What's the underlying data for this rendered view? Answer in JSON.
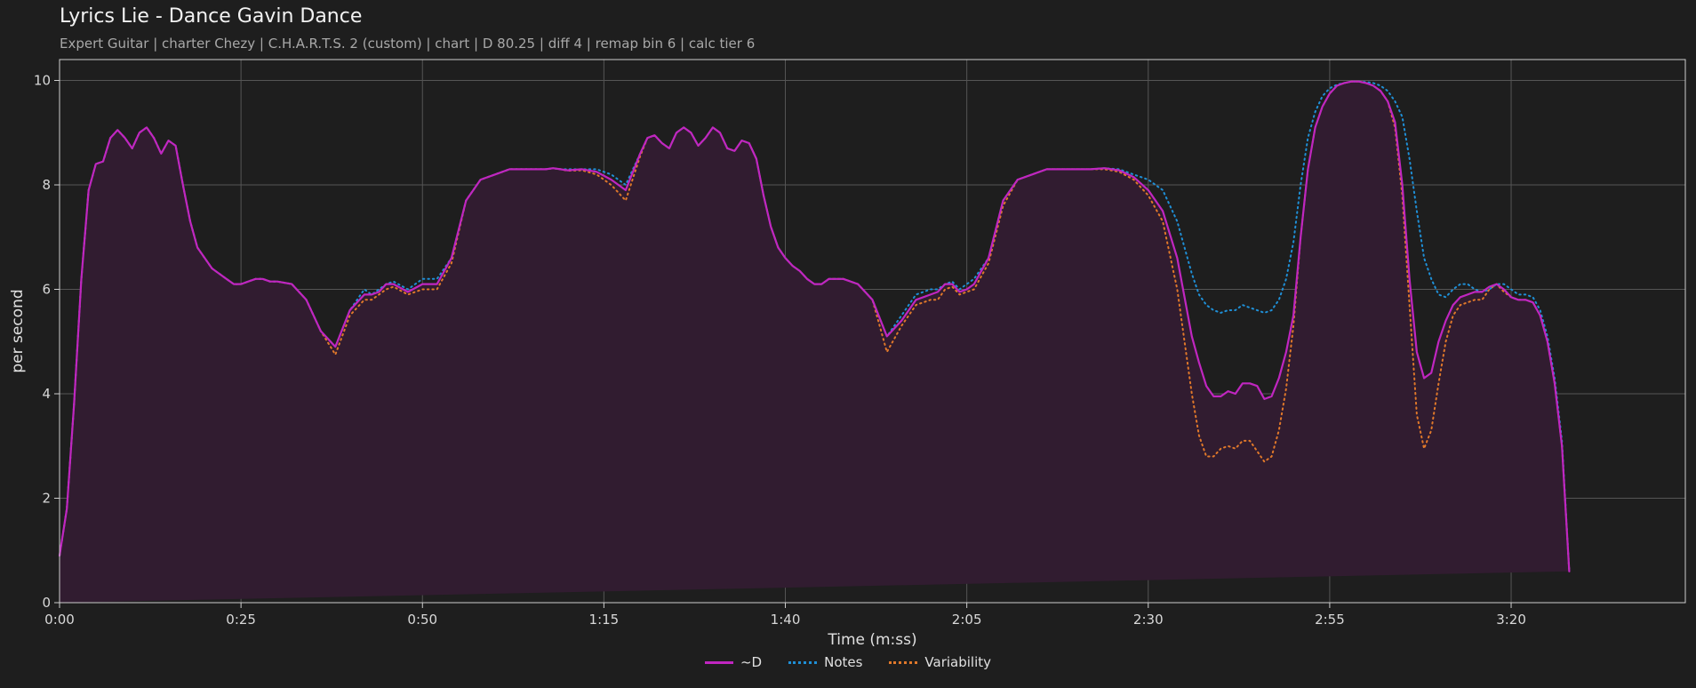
{
  "header": {
    "title": "Lyrics Lie - Dance Gavin Dance",
    "subtitle": "Expert Guitar  |  charter Chezy  |  C.H.A.R.T.S. 2 (custom)  |  chart  |  D 80.25  |  diff 4  |  remap bin 6  |  calc tier 6"
  },
  "colors": {
    "background": "#1e1e1e",
    "d_line": "#c026c0",
    "notes_line": "#1f8fd6",
    "variability_line": "#e0782a",
    "fill": "#311c30",
    "grid": "#555555",
    "axis": "#cfcfcf"
  },
  "chart_data": {
    "type": "line",
    "title": "Lyrics Lie - Dance Gavin Dance",
    "xlabel": "Time (m:ss)",
    "ylabel": "per second",
    "xlim": [
      0,
      224
    ],
    "ylim": [
      0,
      10.4
    ],
    "grid": true,
    "legend_position": "bottom-center",
    "x_ticks": [
      {
        "value": 0,
        "label": "0:00"
      },
      {
        "value": 25,
        "label": "0:25"
      },
      {
        "value": 50,
        "label": "0:50"
      },
      {
        "value": 75,
        "label": "1:15"
      },
      {
        "value": 100,
        "label": "1:40"
      },
      {
        "value": 125,
        "label": "2:05"
      },
      {
        "value": 150,
        "label": "2:30"
      },
      {
        "value": 175,
        "label": "2:55"
      },
      {
        "value": 200,
        "label": "3:20"
      }
    ],
    "y_ticks": [
      0,
      2,
      4,
      6,
      8,
      10
    ],
    "x": [
      0,
      1,
      2,
      3,
      4,
      5,
      6,
      7,
      8,
      9,
      10,
      11,
      12,
      13,
      14,
      15,
      16,
      17,
      18,
      19,
      20,
      21,
      22,
      23,
      24,
      25,
      26,
      27,
      28,
      29,
      30,
      32,
      34,
      36,
      38,
      40,
      42,
      43,
      44,
      45,
      46,
      48,
      50,
      52,
      54,
      56,
      58,
      60,
      62,
      64,
      65,
      66,
      67,
      68,
      69,
      70,
      72,
      74,
      76,
      78,
      80,
      81,
      82,
      83,
      84,
      85,
      86,
      87,
      88,
      89,
      90,
      91,
      92,
      93,
      94,
      95,
      96,
      97,
      98,
      99,
      100,
      101,
      102,
      103,
      104,
      105,
      106,
      108,
      110,
      112,
      114,
      116,
      118,
      120,
      121,
      122,
      123,
      124,
      125,
      126,
      128,
      130,
      132,
      134,
      136,
      138,
      140,
      142,
      144,
      146,
      148,
      150,
      152,
      154,
      156,
      157,
      158,
      159,
      160,
      161,
      162,
      163,
      164,
      165,
      166,
      167,
      168,
      169,
      170,
      171,
      172,
      173,
      174,
      175,
      176,
      177,
      178,
      179,
      180,
      181,
      182,
      183,
      184,
      185,
      186,
      187,
      188,
      189,
      190,
      191,
      192,
      193,
      194,
      195,
      196,
      197,
      198,
      199,
      200,
      201,
      202,
      203,
      204,
      205,
      206,
      207,
      208,
      209,
      210,
      211,
      212,
      213,
      214,
      215,
      216,
      217,
      218,
      219,
      220,
      221,
      222,
      223,
      224
    ],
    "series": [
      {
        "name": "~D",
        "color": "#c026c0",
        "style": "solid",
        "values": [
          0.9,
          1.8,
          3.8,
          6.2,
          7.9,
          8.4,
          8.45,
          8.9,
          9.05,
          8.9,
          8.7,
          9.0,
          9.1,
          8.9,
          8.6,
          8.85,
          8.75,
          8.0,
          7.3,
          6.8,
          6.6,
          6.4,
          6.3,
          6.2,
          6.1,
          6.1,
          6.15,
          6.2,
          6.2,
          6.15,
          6.15,
          6.1,
          5.8,
          5.2,
          4.9,
          5.6,
          5.9,
          5.9,
          5.95,
          6.1,
          6.1,
          5.95,
          6.1,
          6.1,
          6.6,
          7.7,
          8.1,
          8.2,
          8.3,
          8.3,
          8.3,
          8.3,
          8.3,
          8.32,
          8.3,
          8.28,
          8.3,
          8.25,
          8.1,
          7.9,
          8.6,
          8.9,
          8.95,
          8.8,
          8.7,
          9.0,
          9.1,
          9.0,
          8.75,
          8.9,
          9.1,
          9.0,
          8.7,
          8.65,
          8.85,
          8.8,
          8.5,
          7.8,
          7.2,
          6.8,
          6.6,
          6.45,
          6.35,
          6.2,
          6.1,
          6.1,
          6.2,
          6.2,
          6.1,
          5.8,
          5.1,
          5.4,
          5.8,
          5.9,
          5.95,
          6.1,
          6.1,
          5.95,
          6.0,
          6.1,
          6.6,
          7.7,
          8.1,
          8.2,
          8.3,
          8.3,
          8.3,
          8.3,
          8.32,
          8.28,
          8.15,
          7.9,
          7.5,
          6.6,
          5.1,
          4.6,
          4.15,
          3.95,
          3.95,
          4.05,
          4.0,
          4.2,
          4.2,
          4.15,
          3.9,
          3.95,
          4.3,
          4.8,
          5.5,
          7.0,
          8.3,
          9.1,
          9.5,
          9.75,
          9.9,
          9.95,
          9.98,
          9.98,
          9.95,
          9.9,
          9.8,
          9.6,
          9.2,
          8.0,
          6.2,
          4.8,
          4.3,
          4.4,
          5.0,
          5.4,
          5.7,
          5.85,
          5.9,
          5.95,
          5.95,
          6.05,
          6.1,
          6.0,
          5.85,
          5.8,
          5.8,
          5.75,
          5.5,
          5.0,
          4.2,
          3.0,
          0.6
        ]
      },
      {
        "name": "Notes",
        "color": "#1f8fd6",
        "style": "dotted",
        "values": [
          0.9,
          1.8,
          3.8,
          6.2,
          7.9,
          8.4,
          8.45,
          8.9,
          9.05,
          8.9,
          8.7,
          9.0,
          9.1,
          8.9,
          8.6,
          8.85,
          8.75,
          8.0,
          7.3,
          6.8,
          6.6,
          6.4,
          6.3,
          6.2,
          6.1,
          6.1,
          6.15,
          6.2,
          6.2,
          6.15,
          6.15,
          6.1,
          5.8,
          5.2,
          4.9,
          5.6,
          6.0,
          5.9,
          6.0,
          6.1,
          6.15,
          6.0,
          6.2,
          6.2,
          6.6,
          7.7,
          8.1,
          8.2,
          8.3,
          8.3,
          8.3,
          8.3,
          8.3,
          8.32,
          8.3,
          8.3,
          8.3,
          8.3,
          8.2,
          8.0,
          8.6,
          8.9,
          8.95,
          8.8,
          8.7,
          9.0,
          9.1,
          9.0,
          8.75,
          8.9,
          9.1,
          9.0,
          8.7,
          8.65,
          8.85,
          8.8,
          8.5,
          7.8,
          7.2,
          6.8,
          6.6,
          6.45,
          6.35,
          6.2,
          6.1,
          6.1,
          6.2,
          6.2,
          6.1,
          5.8,
          5.1,
          5.5,
          5.9,
          6.0,
          6.0,
          6.1,
          6.15,
          6.0,
          6.1,
          6.2,
          6.6,
          7.7,
          8.1,
          8.2,
          8.3,
          8.3,
          8.3,
          8.3,
          8.32,
          8.3,
          8.2,
          8.1,
          7.9,
          7.3,
          6.3,
          5.9,
          5.7,
          5.6,
          5.55,
          5.6,
          5.6,
          5.7,
          5.65,
          5.6,
          5.55,
          5.6,
          5.8,
          6.2,
          6.9,
          8.0,
          8.9,
          9.4,
          9.7,
          9.85,
          9.92,
          9.95,
          9.98,
          9.98,
          9.97,
          9.95,
          9.9,
          9.8,
          9.6,
          9.3,
          8.5,
          7.5,
          6.6,
          6.2,
          5.9,
          5.85,
          6.0,
          6.1,
          6.1,
          6.0,
          5.95,
          6.0,
          6.1,
          6.1,
          6.0,
          5.9,
          5.9,
          5.85,
          5.6,
          5.1,
          4.3,
          3.1,
          0.6
        ]
      },
      {
        "name": "Variability",
        "color": "#e0782a",
        "style": "dotted",
        "values": [
          0.9,
          1.8,
          3.8,
          6.2,
          7.9,
          8.4,
          8.45,
          8.9,
          9.05,
          8.9,
          8.7,
          9.0,
          9.1,
          8.9,
          8.6,
          8.85,
          8.75,
          8.0,
          7.3,
          6.8,
          6.6,
          6.4,
          6.3,
          6.2,
          6.1,
          6.1,
          6.15,
          6.2,
          6.2,
          6.15,
          6.15,
          6.1,
          5.8,
          5.2,
          4.75,
          5.5,
          5.8,
          5.8,
          5.9,
          6.0,
          6.05,
          5.9,
          6.0,
          6.0,
          6.5,
          7.7,
          8.1,
          8.2,
          8.3,
          8.3,
          8.3,
          8.3,
          8.3,
          8.32,
          8.3,
          8.27,
          8.28,
          8.2,
          8.0,
          7.7,
          8.55,
          8.9,
          8.95,
          8.8,
          8.7,
          9.0,
          9.1,
          9.0,
          8.75,
          8.9,
          9.1,
          9.0,
          8.7,
          8.65,
          8.85,
          8.8,
          8.5,
          7.8,
          7.2,
          6.8,
          6.6,
          6.45,
          6.35,
          6.2,
          6.1,
          6.1,
          6.2,
          6.2,
          6.1,
          5.8,
          4.8,
          5.3,
          5.7,
          5.8,
          5.8,
          6.0,
          6.05,
          5.9,
          5.95,
          6.0,
          6.5,
          7.6,
          8.1,
          8.2,
          8.3,
          8.3,
          8.3,
          8.3,
          8.3,
          8.25,
          8.1,
          7.8,
          7.3,
          6.0,
          4.0,
          3.2,
          2.8,
          2.8,
          2.95,
          3.0,
          2.95,
          3.1,
          3.1,
          2.9,
          2.7,
          2.8,
          3.3,
          4.1,
          5.3,
          7.0,
          8.3,
          9.1,
          9.5,
          9.75,
          9.9,
          9.95,
          9.98,
          9.98,
          9.95,
          9.9,
          9.8,
          9.6,
          9.1,
          7.8,
          5.7,
          3.6,
          2.95,
          3.3,
          4.2,
          5.0,
          5.5,
          5.7,
          5.75,
          5.8,
          5.8,
          6.0,
          6.1,
          5.95,
          5.85,
          5.8,
          5.8,
          5.75,
          5.5,
          5.0,
          4.2,
          3.0,
          0.6
        ]
      }
    ]
  }
}
